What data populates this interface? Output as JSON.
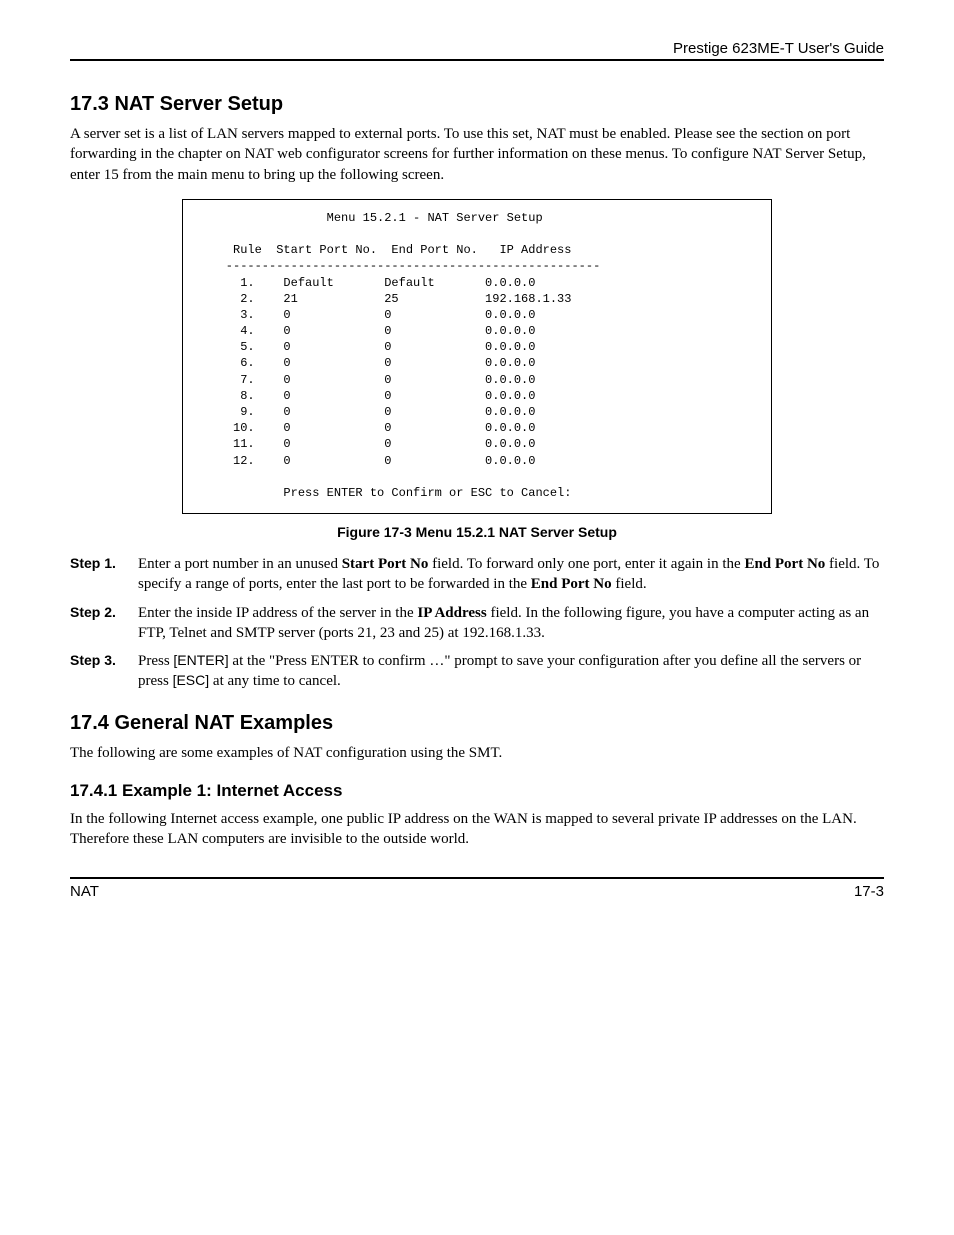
{
  "header": {
    "guide_title": "Prestige 623ME-T User's Guide"
  },
  "section_17_3": {
    "heading": "17.3  NAT Server Setup",
    "intro": "A server set is a list of LAN servers mapped to external ports. To use this set, NAT must be enabled. Please see the section on port forwarding in the chapter on NAT web configurator screens for further information on these menus. To configure NAT Server Setup, enter 15 from the main menu to bring up the following screen.",
    "menu": {
      "title": "Menu 15.2.1 - NAT Server Setup",
      "columns": {
        "c1": "Rule",
        "c2": "Start Port No.",
        "c3": "End Port No.",
        "c4": "IP Address"
      },
      "rows": [
        {
          "rule": "1.",
          "start": "Default",
          "end": "Default",
          "ip": "0.0.0.0"
        },
        {
          "rule": "2.",
          "start": "21",
          "end": "25",
          "ip": "192.168.1.33"
        },
        {
          "rule": "3.",
          "start": "0",
          "end": "0",
          "ip": "0.0.0.0"
        },
        {
          "rule": "4.",
          "start": "0",
          "end": "0",
          "ip": "0.0.0.0"
        },
        {
          "rule": "5.",
          "start": "0",
          "end": "0",
          "ip": "0.0.0.0"
        },
        {
          "rule": "6.",
          "start": "0",
          "end": "0",
          "ip": "0.0.0.0"
        },
        {
          "rule": "7.",
          "start": "0",
          "end": "0",
          "ip": "0.0.0.0"
        },
        {
          "rule": "8.",
          "start": "0",
          "end": "0",
          "ip": "0.0.0.0"
        },
        {
          "rule": "9.",
          "start": "0",
          "end": "0",
          "ip": "0.0.0.0"
        },
        {
          "rule": "10.",
          "start": "0",
          "end": "0",
          "ip": "0.0.0.0"
        },
        {
          "rule": "11.",
          "start": "0",
          "end": "0",
          "ip": "0.0.0.0"
        },
        {
          "rule": "12.",
          "start": "0",
          "end": "0",
          "ip": "0.0.0.0"
        }
      ],
      "confirm": "Press ENTER to Confirm or ESC to Cancel:"
    },
    "figure_caption": "Figure 17-3 Menu 15.2.1 NAT Server Setup",
    "steps": [
      {
        "label": "Step 1.",
        "t1": "Enter a port number in an unused ",
        "b1": "Start Port No",
        "t2": " field. To forward only one port, enter it again in the ",
        "b2": "End Port No",
        "t3": " field. To specify a range of ports, enter the last port to be forwarded in the ",
        "b3": "End Port No",
        "t4": " field."
      },
      {
        "label": "Step 2.",
        "t1": "Enter the inside IP address of the server in the ",
        "b1": "IP Address",
        "t2": " field. In the following figure, you have a computer acting as an FTP, Telnet and SMTP server (ports 21, 23 and 25) at 192.168.1.33."
      },
      {
        "label": "Step 3.",
        "t1": "Press ",
        "k1": "[ENTER]",
        "t2": " at the \"Press ENTER to confirm …\" prompt to save your configuration after you define all the servers or press ",
        "k2": "[ESC]",
        "t3": " at any time to cancel."
      }
    ]
  },
  "section_17_4": {
    "heading": "17.4  General NAT Examples",
    "intro": "The following are some examples of NAT configuration using the SMT.",
    "sub_17_4_1": {
      "heading": "17.4.1 Example 1: Internet Access",
      "body": "In the following Internet access example, one public IP address on the WAN is mapped to several private IP addresses on the LAN. Therefore these LAN computers are invisible to the outside world."
    }
  },
  "footer": {
    "left": "NAT",
    "right": "17-3"
  }
}
